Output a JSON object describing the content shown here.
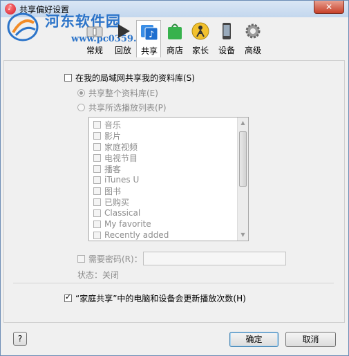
{
  "window": {
    "title": "共享偏好设置",
    "close_glyph": "✕",
    "app_icon": "itunes-icon"
  },
  "watermark": {
    "site_name": "河东软件园",
    "url": "www.pc0359.cn"
  },
  "toolbar": {
    "tabs": [
      {
        "label": "常规",
        "icon": "switch-icon"
      },
      {
        "label": "回放",
        "icon": "play-icon"
      },
      {
        "label": "共享",
        "icon": "music-share-icon",
        "active": true
      },
      {
        "label": "商店",
        "icon": "bag-icon"
      },
      {
        "label": "家长",
        "icon": "parent-icon"
      },
      {
        "label": "设备",
        "icon": "phone-icon"
      },
      {
        "label": "高级",
        "icon": "gear-icon"
      }
    ]
  },
  "sharing": {
    "share_library_label": "在我的局域网共享我的资料库(S)",
    "share_entire_label": "共享整个资料库(E)",
    "share_selected_label": "共享所选播放列表(P)",
    "playlists": [
      "音乐",
      "影片",
      "家庭视频",
      "电视节目",
      "播客",
      "iTunes U",
      "图书",
      "已购买",
      "Classical",
      "My favorite",
      "Recently added"
    ],
    "require_password_label": "需要密码(R)：",
    "status_label": "状态：关闭",
    "home_share_label": "“家庭共享”中的电脑和设备会更新播放次数(H)"
  },
  "buttons": {
    "help": "?",
    "ok": "确定",
    "cancel": "取消"
  }
}
